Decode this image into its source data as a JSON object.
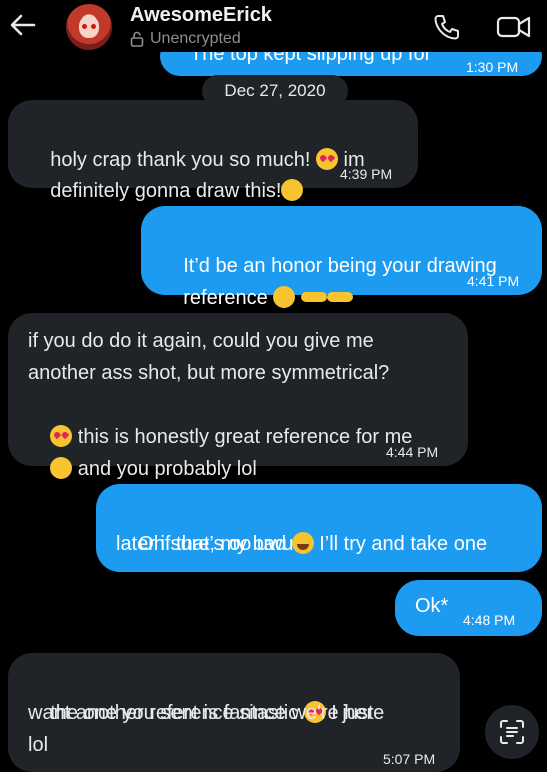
{
  "header": {
    "name": "AwesomeErick",
    "status": "Unencrypted"
  },
  "date_chip": "Dec 27, 2020",
  "messages": [
    {
      "direction": "out",
      "text": "The top kept slipping up for",
      "time": "1:30 PM"
    },
    {
      "direction": "in",
      "lines": [
        "holy crap thank you so much!",
        "im",
        "definitely gonna draw this!"
      ],
      "time": "4:39 PM"
    },
    {
      "direction": "out",
      "lines": [
        "It’d be an honor being your drawing",
        "reference"
      ],
      "time": "4:41 PM"
    },
    {
      "direction": "in",
      "lines": [
        "if you do do it again, could you give me",
        "another ass shot, but more symmetrical?",
        "this is honestly great reference for me",
        "and you probably lol"
      ],
      "time": "4:44 PM"
    },
    {
      "direction": "out",
      "lines": [
        "Oh sure, my bad",
        "I’ll try and take one",
        "later if that’s oo uwu"
      ],
      "time": "4:48 PM"
    },
    {
      "direction": "out",
      "lines": [
        "Ok*"
      ],
      "time": "4:48 PM"
    },
    {
      "direction": "in",
      "lines": [
        "the one you sent is fantastic",
        "I just",
        "want another reference since we're here",
        "lol"
      ],
      "time": "5:07 PM"
    }
  ],
  "icons": {
    "back": "back-arrow-icon",
    "call": "phone-icon",
    "video": "video-camera-icon",
    "lock": "lock-icon",
    "scan": "text-scan-icon"
  },
  "colors": {
    "background": "#000000",
    "incoming_bubble": "#202327",
    "outgoing_bubble": "#1d9bf0"
  }
}
